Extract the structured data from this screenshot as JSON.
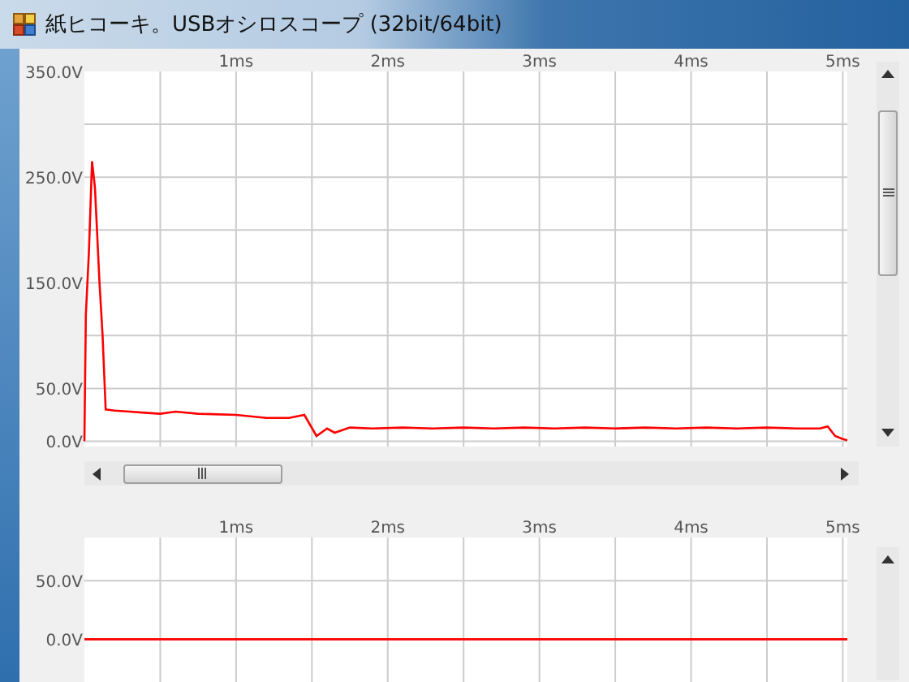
{
  "window": {
    "title": "紙ヒコーキ。USBオシロスコープ (32bit/64bit)"
  },
  "charts": [
    {
      "chart_data": {
        "type": "line",
        "grid": true,
        "xlim": [
          0,
          5.03
        ],
        "ylim": [
          -5,
          350
        ],
        "xticks": [
          {
            "value": 1,
            "label": "1ms"
          },
          {
            "value": 2,
            "label": "2ms"
          },
          {
            "value": 3,
            "label": "3ms"
          },
          {
            "value": 4,
            "label": "4ms"
          },
          {
            "value": 5,
            "label": "5ms"
          }
        ],
        "yticks": [
          {
            "value": 350,
            "label": "350.0V"
          },
          {
            "value": 250,
            "label": "250.0V"
          },
          {
            "value": 150,
            "label": "150.0V"
          },
          {
            "value": 50,
            "label": "50.0V"
          },
          {
            "value": 0,
            "label": "0.0V"
          }
        ],
        "x": [
          0,
          0.01,
          0.03,
          0.05,
          0.07,
          0.1,
          0.12,
          0.14,
          0.2,
          0.3,
          0.4,
          0.5,
          0.6,
          0.75,
          1.0,
          1.2,
          1.35,
          1.45,
          1.53,
          1.6,
          1.65,
          1.75,
          1.9,
          2.1,
          2.3,
          2.5,
          2.7,
          2.9,
          3.1,
          3.3,
          3.5,
          3.7,
          3.9,
          4.1,
          4.3,
          4.5,
          4.7,
          4.85,
          4.9,
          4.95,
          5.0,
          5.03
        ],
        "series": [
          {
            "color": "#ff0000",
            "values": [
              0,
              120,
              180,
              265,
              240,
              150,
              100,
              30,
              29,
              28,
              27,
              26,
              28,
              26,
              25,
              22,
              22,
              25,
              5,
              12,
              8,
              13,
              12,
              13,
              12,
              13,
              12,
              13,
              12,
              13,
              12,
              13,
              12,
              13,
              12,
              13,
              12,
              12,
              14,
              5,
              2,
              1
            ]
          }
        ]
      }
    },
    {
      "chart_data": {
        "type": "line",
        "grid": true,
        "xlim": [
          0,
          5.03
        ],
        "ylim": [
          -42,
          87
        ],
        "xticks": [
          {
            "value": 1,
            "label": "1ms"
          },
          {
            "value": 2,
            "label": "2ms"
          },
          {
            "value": 3,
            "label": "3ms"
          },
          {
            "value": 4,
            "label": "4ms"
          },
          {
            "value": 5,
            "label": "5ms"
          }
        ],
        "yticks": [
          {
            "value": 50,
            "label": "50.0V"
          },
          {
            "value": 0,
            "label": "0.0V"
          }
        ],
        "x": [
          0,
          5.03
        ],
        "series": [
          {
            "color": "#ff0000",
            "values": [
              0,
              0
            ]
          }
        ]
      }
    }
  ]
}
